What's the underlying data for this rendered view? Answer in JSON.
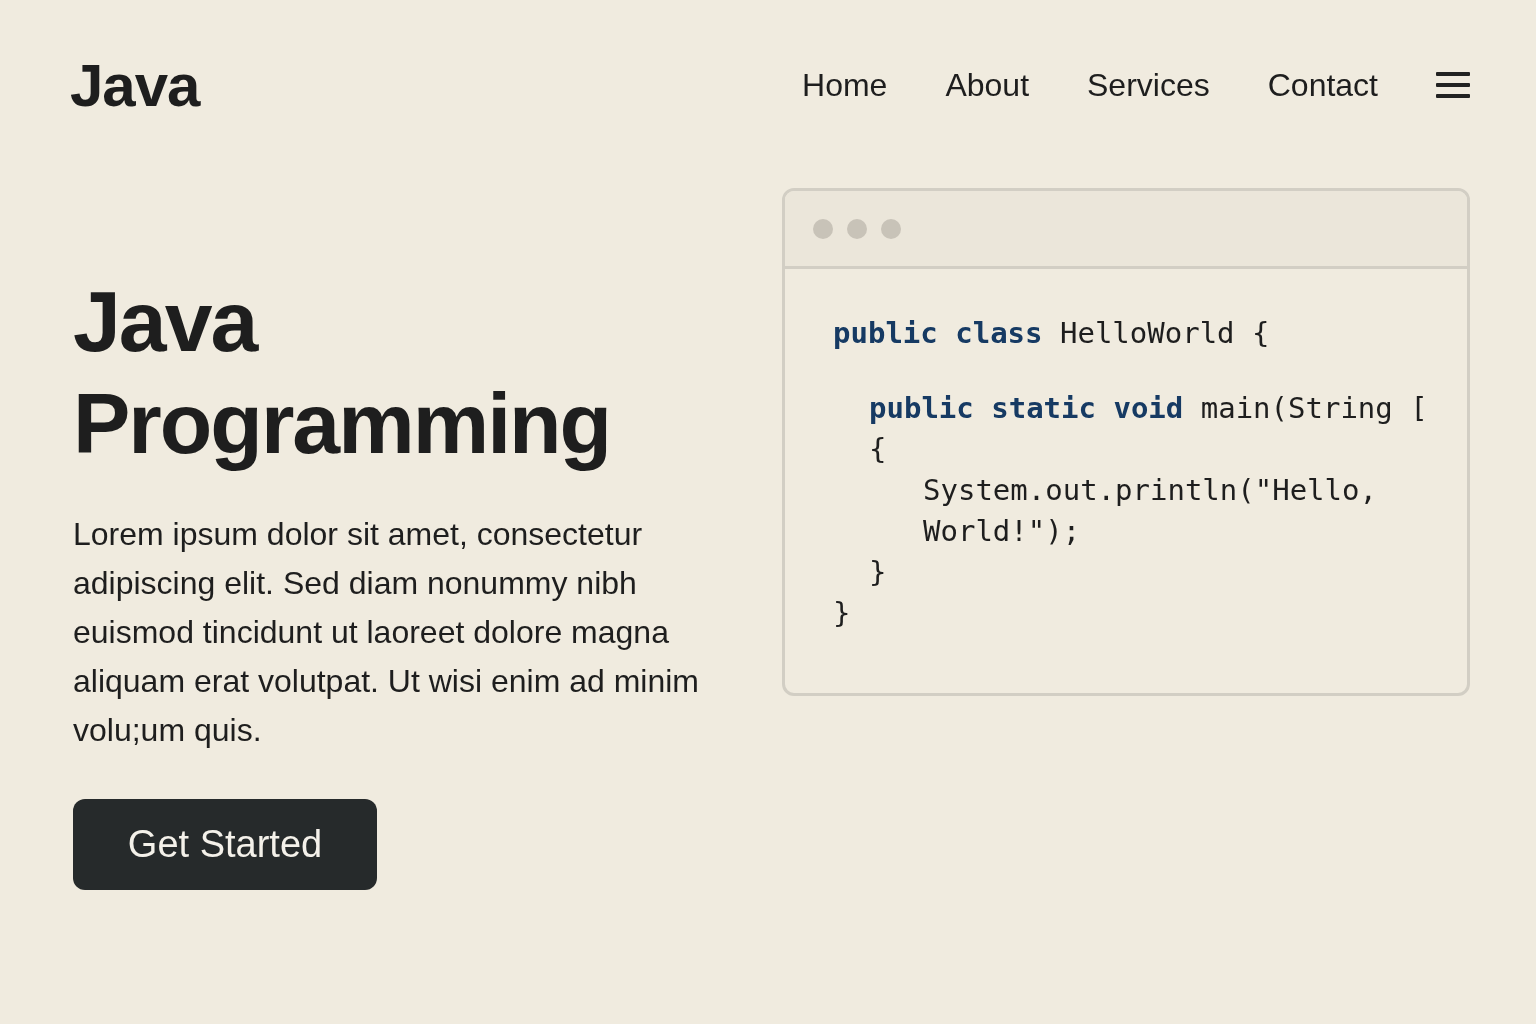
{
  "header": {
    "logo": "Java",
    "nav": [
      {
        "label": "Home"
      },
      {
        "label": "About"
      },
      {
        "label": "Services"
      },
      {
        "label": "Contact"
      }
    ]
  },
  "hero": {
    "title_lines": [
      "Java",
      "Programming"
    ],
    "paragraph": "Lorem ipsum dolor sit amet, consectetur adipiscing elit. Sed diam nonummy nibh euismod tincidunt ut laoreet dolore magna aliquam erat volutpat. Ut wisi enim ad minim volu;um quis.",
    "button": "Get Started"
  },
  "code": {
    "lines": [
      {
        "tokens": [
          {
            "text": "public class ",
            "kind": "keyword"
          },
          {
            "text": "HelloWorld {",
            "kind": "plain"
          }
        ],
        "children": [
          {
            "tokens": [
              {
                "text": "public static void ",
                "kind": "keyword"
              },
              {
                "text": "main(String [",
                "kind": "plain"
              }
            ]
          },
          {
            "tokens": [
              {
                "text": "{",
                "kind": "plain"
              }
            ],
            "children": [
              {
                "tokens": [
                  {
                    "text": "System.out.println(\"Hello, World!\");",
                    "kind": "plain"
                  }
                ]
              }
            ]
          },
          {
            "tokens": [
              {
                "text": "}",
                "kind": "plain"
              }
            ]
          }
        ]
      },
      {
        "tokens": [
          {
            "text": "}",
            "kind": "plain"
          }
        ]
      }
    ]
  }
}
